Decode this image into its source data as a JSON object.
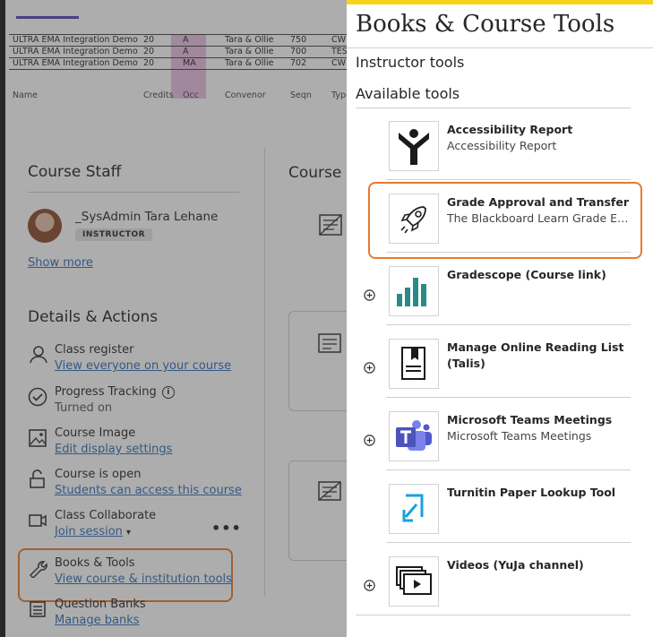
{
  "table": {
    "rows": [
      [
        "ULTRA EMA Integration Demo",
        "20",
        "A",
        "Tara & Ollie",
        "750",
        "CW"
      ],
      [
        "ULTRA EMA Integration Demo",
        "20",
        "A",
        "Tara & Ollie",
        "700",
        "TEST"
      ],
      [
        "ULTRA EMA Integration Demo",
        "20",
        "MA",
        "Tara & Ollie",
        "702",
        "CW"
      ]
    ],
    "headers": [
      "Name",
      "Credits",
      "Occ",
      "Convenor",
      "Seqn",
      "Type"
    ]
  },
  "course_staff": {
    "title": "Course Staff",
    "name": "_SysAdmin Tara Lehane",
    "role": "INSTRUCTOR",
    "show_more": "Show more"
  },
  "details": {
    "title": "Details & Actions",
    "class_register": {
      "title": "Class register",
      "link": "View everyone on your course"
    },
    "progress": {
      "title": "Progress Tracking",
      "status": "Turned on"
    },
    "course_image": {
      "title": "Course Image",
      "link": "Edit display settings"
    },
    "course_open": {
      "title": "Course is open",
      "link": "Students can access this course"
    },
    "collaborate": {
      "title": "Class Collaborate",
      "link": "Join session"
    },
    "books_tools": {
      "title": "Books & Tools",
      "link": "View course & institution tools"
    },
    "question_banks": {
      "title": "Question Banks",
      "link": "Manage banks"
    }
  },
  "course_content_title": "Course C",
  "panel": {
    "title": "Books & Course Tools",
    "instructor_tools": "Instructor tools",
    "available_tools": "Available tools",
    "tools": [
      {
        "name": "Accessibility Report",
        "desc": "Accessibility Report",
        "icon": "accessibility-icon"
      },
      {
        "name": "Grade Approval and Transfer",
        "desc": "The Blackboard Learn Grade Exp...",
        "icon": "rocket-icon"
      },
      {
        "name": "Gradescope (Course link)",
        "desc": "",
        "icon": "gradescope-icon"
      },
      {
        "name": "Manage Online Reading List (Talis)",
        "desc": "",
        "icon": "reading-list-icon"
      },
      {
        "name": "Microsoft Teams Meetings",
        "desc": "Microsoft Teams Meetings",
        "icon": "teams-icon"
      },
      {
        "name": "Turnitin Paper Lookup Tool",
        "desc": "",
        "icon": "turnitin-icon"
      },
      {
        "name": "Videos (YuJa channel)",
        "desc": "",
        "icon": "video-icon"
      }
    ]
  },
  "colors": {
    "accent_yellow": "#f5d51c",
    "highlight_orange": "#e87a2d",
    "link_blue": "#2f6fb8",
    "teams_purple": "#5059c9",
    "gradescope_teal": "#2a8a86",
    "turnitin_blue": "#1a9fe0"
  }
}
